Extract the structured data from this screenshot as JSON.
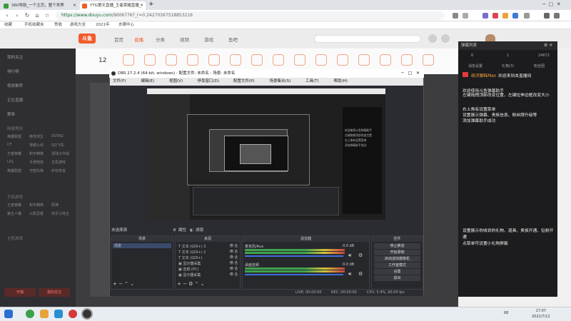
{
  "browser": {
    "tabs": [
      {
        "label": "360导航_一个主页，整个世界",
        "color": "#3a9c3a"
      },
      {
        "label": "YTG第天直播_王者荣耀直播_",
        "color": "#f25c2a"
      }
    ],
    "new_tab": "+",
    "url_host": "https://www.douyu.com",
    "url_path": "/9606776?_r=0.24270367518853216",
    "bookmarks": [
      "收藏",
      "手机收藏夹",
      "赞收",
      "游戏大全",
      "2021年",
      "去哪中心"
    ]
  },
  "douyu": {
    "logo": "斗鱼",
    "nav": [
      "首页",
      "直播",
      "分类",
      "视频",
      "游戏",
      "鱼吧"
    ],
    "left_items": [
      "我的关注",
      "排行榜",
      "视频推荐",
      "正在直播",
      "赛事"
    ],
    "left_section1": "网游竞技",
    "left_grid": [
      "英雄联盟",
      "绝地求生",
      "DOTA2",
      "CF",
      "穿越火线",
      "QQ飞车",
      "王者荣耀",
      "和平精英",
      "球球大作战",
      "LOL",
      "手游竞技",
      "主机游戏",
      "英雄联盟",
      "守望先锋",
      "炉石传说"
    ],
    "left_section2": "手机游戏",
    "left_grid2": [
      "王者荣耀",
      "和平精英",
      "原神",
      "第五人格",
      "火影忍者",
      "欢乐斗地主"
    ],
    "left_section3": "主机游戏",
    "left_btns": [
      "开播",
      "我的关注"
    ],
    "cat_badge": "12"
  },
  "chat": {
    "title": "弹幕列表",
    "stats": [
      "6",
      "1",
      "24672"
    ],
    "tabs": [
      "消息设置",
      "礼物(3)",
      "粉丝团"
    ],
    "messages": [
      "欢迎来到本直播间",
      "欢迎使用斗鱼弹幕助手",
      "左键拖拽顶部改变位置，左键拉伸边框改变大小",
      "右上角有设置菜单",
      "设置展示弹幕、贵族信息、粉丝牌升级等",
      "添加弹幕助手成功",
      "设置展示你收到的礼物、道具、贵族开通、钻粉开通",
      "点菜单可设置小礼物屏蔽"
    ],
    "user": "续济脚韩Man"
  },
  "obs": {
    "title": "OBS 27.2.4 (64-bit, windows) - 配置文件: 未命名 - 场景: 未命名",
    "menu": [
      "文件(F)",
      "编辑(E)",
      "视图(V)",
      "停靠窗口(D)",
      "配置文件(P)",
      "场景集合(S)",
      "工具(T)",
      "帮助(H)"
    ],
    "bar_left": "未选择源",
    "bar_props": "属性",
    "bar_filters": "滤镜",
    "docks": {
      "scenes": "场景",
      "sources": "来源",
      "mixer": "混音器",
      "controls": "控件"
    },
    "scene_item": "场景",
    "sources": [
      "文本 (GDI+) 3",
      "文本 (GDI+) 2",
      "文本 (GDI+)",
      "显示器采集",
      "音频 (PC)",
      "显示器采集"
    ],
    "mixer_tracks": [
      {
        "name": "麦克风/Aux",
        "db": "0.0 dB"
      },
      {
        "name": "桌面音频",
        "db": "0.0 dB"
      }
    ],
    "controls": [
      "停止推流",
      "开始录制",
      "启动虚拟摄像机",
      "工作室模式",
      "设置",
      "退出"
    ],
    "status": [
      "LIVE: 00:00:00",
      "REC: 00:00:00",
      "CPU: 5.4%, 60.00 fps"
    ],
    "preview_lines": [
      "欢迎使用斗鱼弹幕助手",
      "左键拖拽顶部改变位置",
      "右上角有设置菜单",
      "添加弹幕助手成功"
    ]
  },
  "taskbar": {
    "time": "17:07",
    "date": "2022/7/12",
    "tray": "68"
  }
}
